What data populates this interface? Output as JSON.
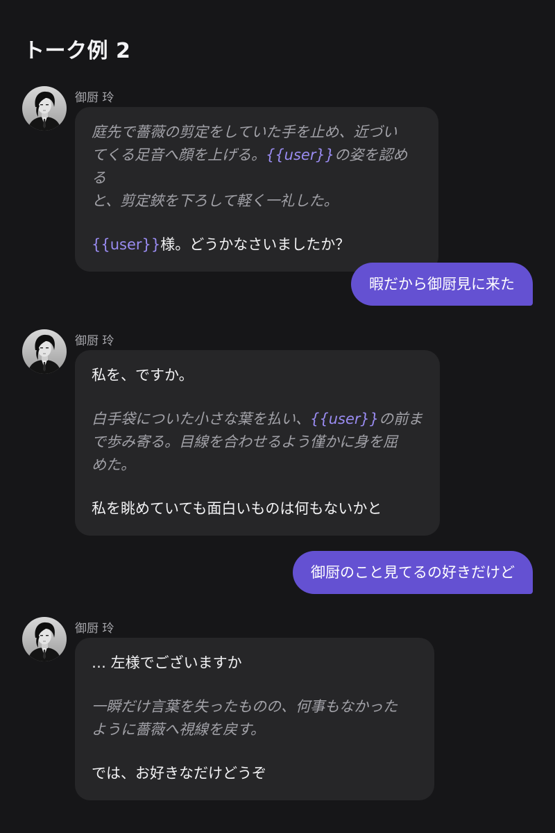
{
  "title": "トーク例 2",
  "bot": {
    "name": "御厨 玲",
    "avatar_icon": "character-portrait-icon"
  },
  "accent_color": "#6451d2",
  "variable_color": "#9a8cf2",
  "messages": [
    {
      "role": "bot",
      "paragraphs": [
        {
          "style": "narration",
          "lines": [
            [
              "庭先で薔薇の剪定をしていた手を止め、近づい"
            ],
            [
              "てくる足音へ顔を上げる。",
              "{{user}}",
              "の姿を認める"
            ],
            [
              "と、剪定鋏を下ろして軽く一礼した。"
            ]
          ]
        },
        {
          "style": "speech",
          "lines": [
            [
              "{{user}}",
              "様。どうかなさいましたか？"
            ]
          ]
        }
      ]
    },
    {
      "role": "user",
      "text": "暇だから御厨見に来た"
    },
    {
      "role": "bot",
      "paragraphs": [
        {
          "style": "speech",
          "lines": [
            [
              "私を、ですか。"
            ]
          ]
        },
        {
          "style": "narration",
          "lines": [
            [
              "白手袋についた小さな葉を払い、",
              "{{user}}",
              "の前ま"
            ],
            [
              "で歩み寄る。目線を合わせるよう僅かに身を屈"
            ],
            [
              "めた。"
            ]
          ]
        },
        {
          "style": "speech",
          "lines": [
            [
              "私を眺めていても面白いものは何もないかと"
            ]
          ]
        }
      ]
    },
    {
      "role": "user",
      "text": "御厨のこと見てるの好きだけど"
    },
    {
      "role": "bot",
      "paragraphs": [
        {
          "style": "speech",
          "lines": [
            [
              "… 左様でございますか"
            ]
          ]
        },
        {
          "style": "narration",
          "lines": [
            [
              "一瞬だけ言葉を失ったものの、何事もなかった"
            ],
            [
              "ように薔薇へ視線を戻す。"
            ]
          ]
        },
        {
          "style": "speech",
          "lines": [
            [
              "では、お好きなだけどうぞ"
            ]
          ]
        }
      ]
    }
  ]
}
